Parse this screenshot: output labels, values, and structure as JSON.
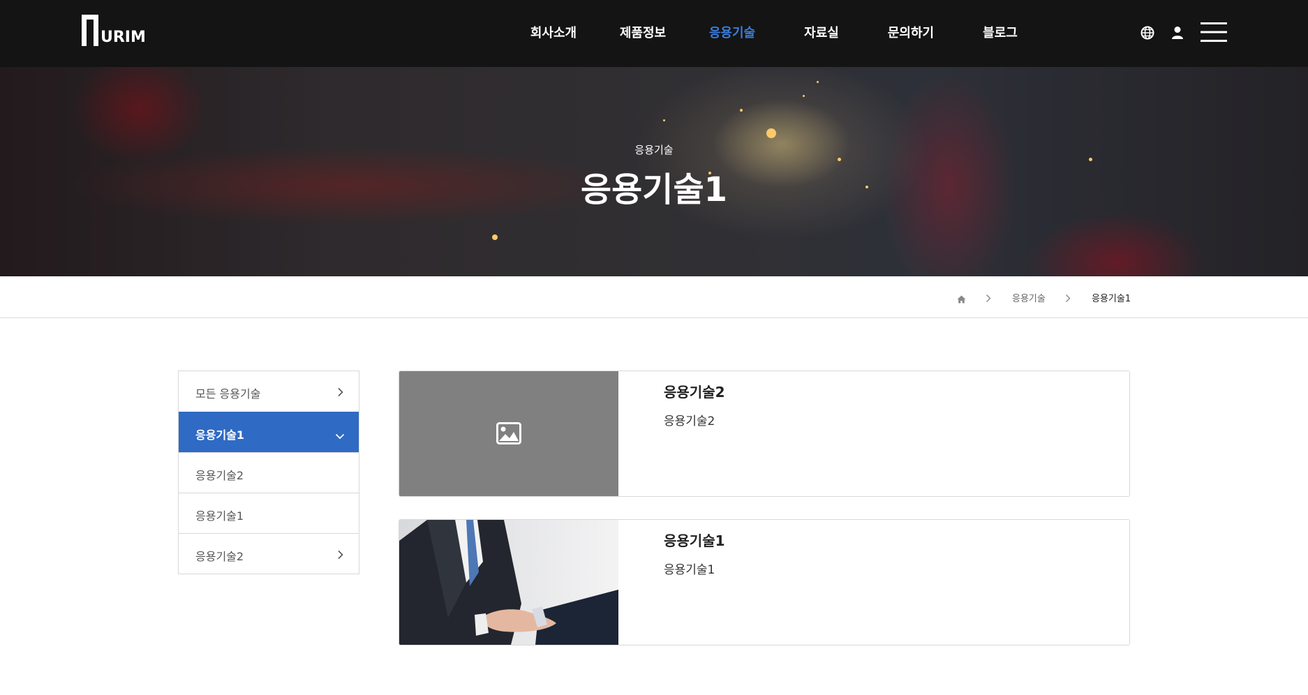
{
  "brand": {
    "logo_text": "URIM"
  },
  "nav": {
    "items": [
      {
        "label": "회사소개"
      },
      {
        "label": "제품정보"
      },
      {
        "label": "응용기술",
        "active": true
      },
      {
        "label": "자료실"
      },
      {
        "label": "문의하기"
      },
      {
        "label": "블로그"
      }
    ]
  },
  "header_icons": [
    "globe-icon",
    "user-icon",
    "hamburger-menu-icon"
  ],
  "hero": {
    "subtitle": "응용기술",
    "title": "응용기술1"
  },
  "breadcrumb": {
    "items": [
      "응용기술",
      "응용기술1"
    ]
  },
  "sidebar": {
    "items": [
      {
        "label": "모든 응용기술",
        "icon": "chevron-right-icon"
      },
      {
        "label": "응용기술1",
        "icon": "chevron-down-icon",
        "active": true
      },
      {
        "label": "응용기술2"
      },
      {
        "label": "응용기술1"
      },
      {
        "label": "응용기술2",
        "icon": "chevron-right-icon"
      }
    ]
  },
  "posts": [
    {
      "title": "응용기술2",
      "description": "응용기술2",
      "thumbnail": "image-placeholder-icon"
    },
    {
      "title": "응용기술1",
      "description": "응용기술1",
      "thumbnail": "handshake-photo"
    }
  ],
  "colors": {
    "header_bg": "#141414",
    "accent": "#2f6ac4",
    "nav_active": "#3b7ddd"
  }
}
